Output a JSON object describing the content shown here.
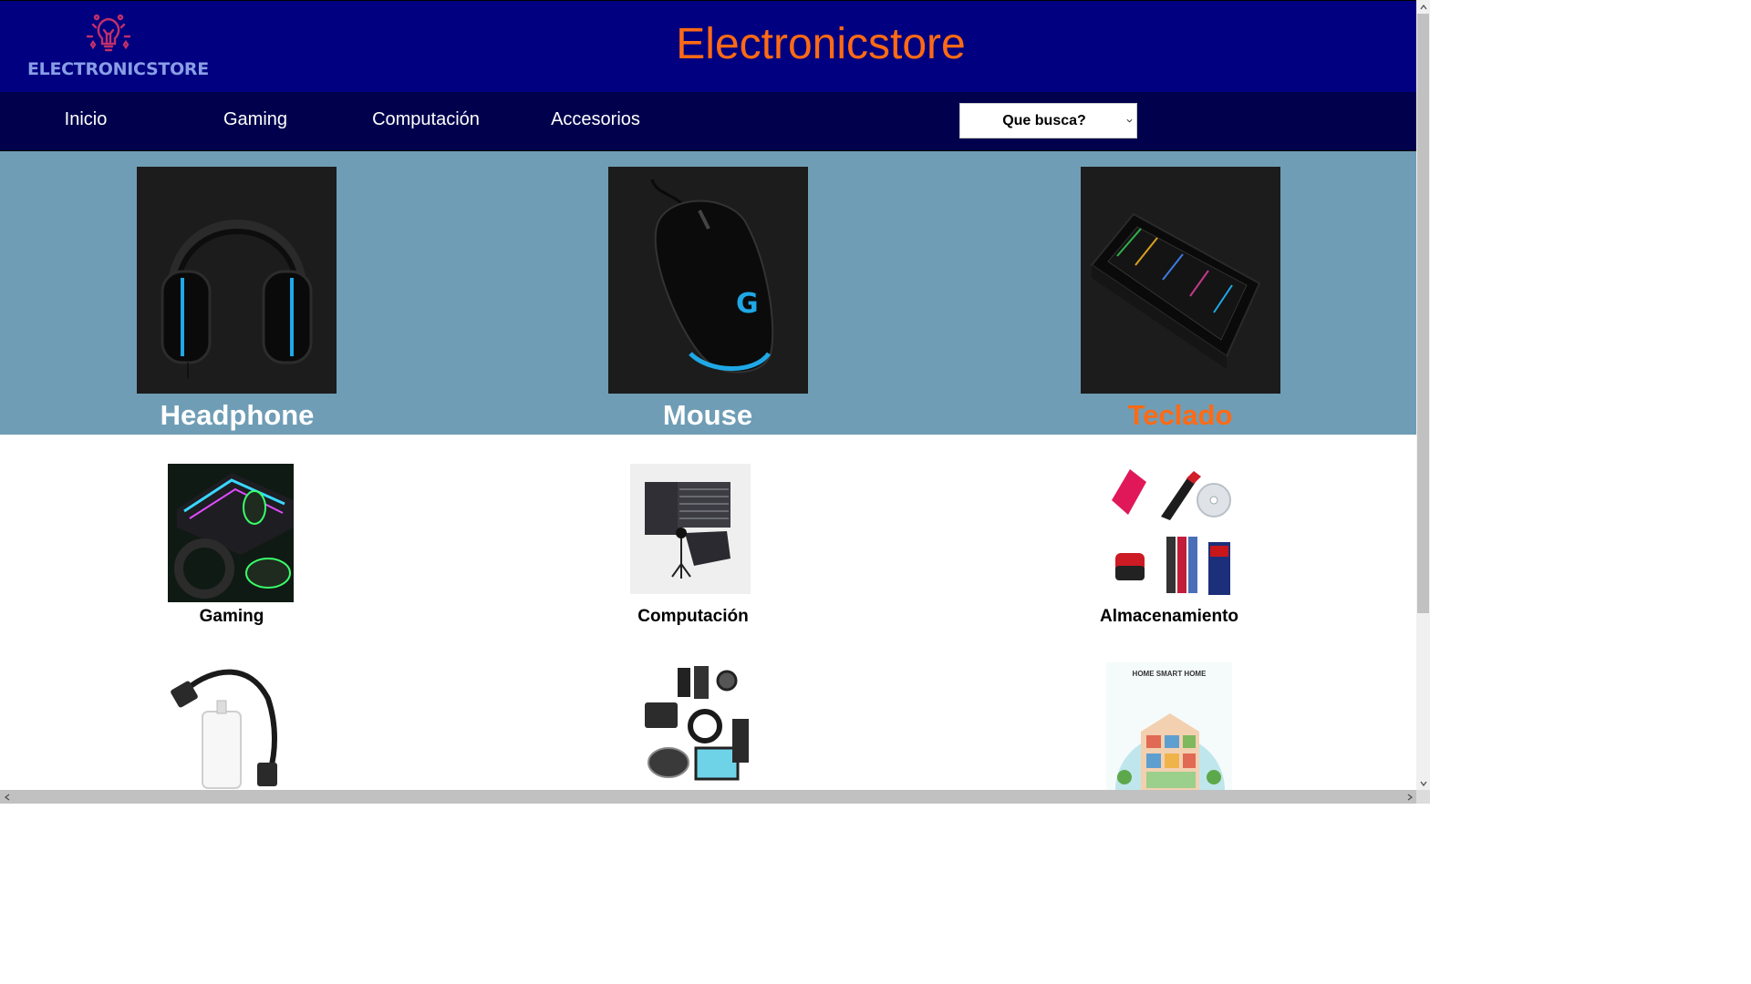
{
  "header": {
    "logo_text": "ELECTRONICSTORE",
    "site_title": "Electronicstore",
    "logo_icon": "lightbulb-icon"
  },
  "nav": {
    "items": [
      {
        "label": "Inicio"
      },
      {
        "label": "Gaming"
      },
      {
        "label": "Computación"
      },
      {
        "label": "Accesorios"
      }
    ],
    "search_select": {
      "selected": "Que busca?"
    }
  },
  "hero": {
    "items": [
      {
        "label": "Headphone",
        "icon": "headphone-icon"
      },
      {
        "label": "Mouse",
        "icon": "mouse-icon"
      },
      {
        "label": "Teclado",
        "icon": "keyboard-icon",
        "active": true
      }
    ]
  },
  "categories": {
    "row1": [
      {
        "label": "Gaming"
      },
      {
        "label": "Computación"
      },
      {
        "label": "Almacenamiento"
      }
    ],
    "row2_images": [
      "adapter-cable",
      "electronics-devices",
      "smart-home"
    ],
    "smart_home_caption": "HOME SMART HOME"
  },
  "colors": {
    "header_bg": "#000080",
    "nav_bg": "#00004d",
    "accent": "#ff6a14",
    "hero_bg": "#6f9db5"
  }
}
